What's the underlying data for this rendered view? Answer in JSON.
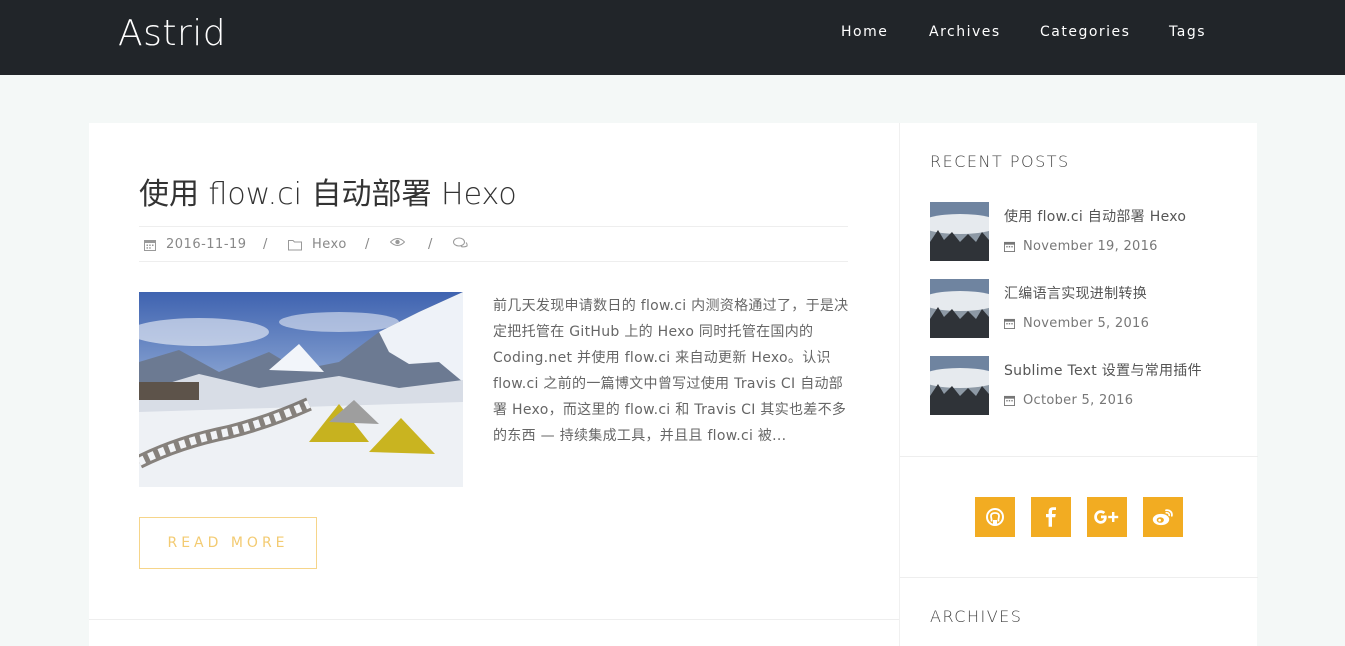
{
  "header": {
    "brand": "Astrid",
    "nav": [
      {
        "label": "Home"
      },
      {
        "label": "Archives"
      },
      {
        "label": "Categories"
      },
      {
        "label": "Tags"
      }
    ]
  },
  "post": {
    "title": "使用 flow.ci 自动部署 Hexo",
    "date": "2016-11-19",
    "category": "Hexo",
    "separator": "/",
    "excerpt": "前几天发现申请数日的 flow.ci 内测资格通过了，于是决定把托管在 GitHub 上的 Hexo 同时托管在国内的 Coding.net 并使用 flow.ci 来自动更新 Hexo。认识 flow.ci 之前的一篇博文中曾写过使用 Travis CI 自动部署 Hexo，而这里的 flow.ci 和 Travis CI 其实也差不多的东西 — 持续集成工具，并且且 flow.ci 被...",
    "read_more": "READ MORE"
  },
  "sidebar": {
    "recent_title": "RECENT POSTS",
    "recent": [
      {
        "title": "使用 flow.ci 自动部署 Hexo",
        "date": "November 19, 2016"
      },
      {
        "title": "汇编语言实现进制转换",
        "date": "November 5, 2016"
      },
      {
        "title": "Sublime Text 设置与常用插件",
        "date": "October 5, 2016"
      }
    ],
    "social": [
      {
        "icon": "github-icon"
      },
      {
        "icon": "facebook-icon"
      },
      {
        "icon": "google-plus-icon"
      },
      {
        "icon": "weibo-icon"
      }
    ],
    "archives_title": "ARCHIVES"
  },
  "colors": {
    "header_bg": "#212529",
    "accent": "#f2ac22",
    "page_bg": "#f4f8f7"
  }
}
